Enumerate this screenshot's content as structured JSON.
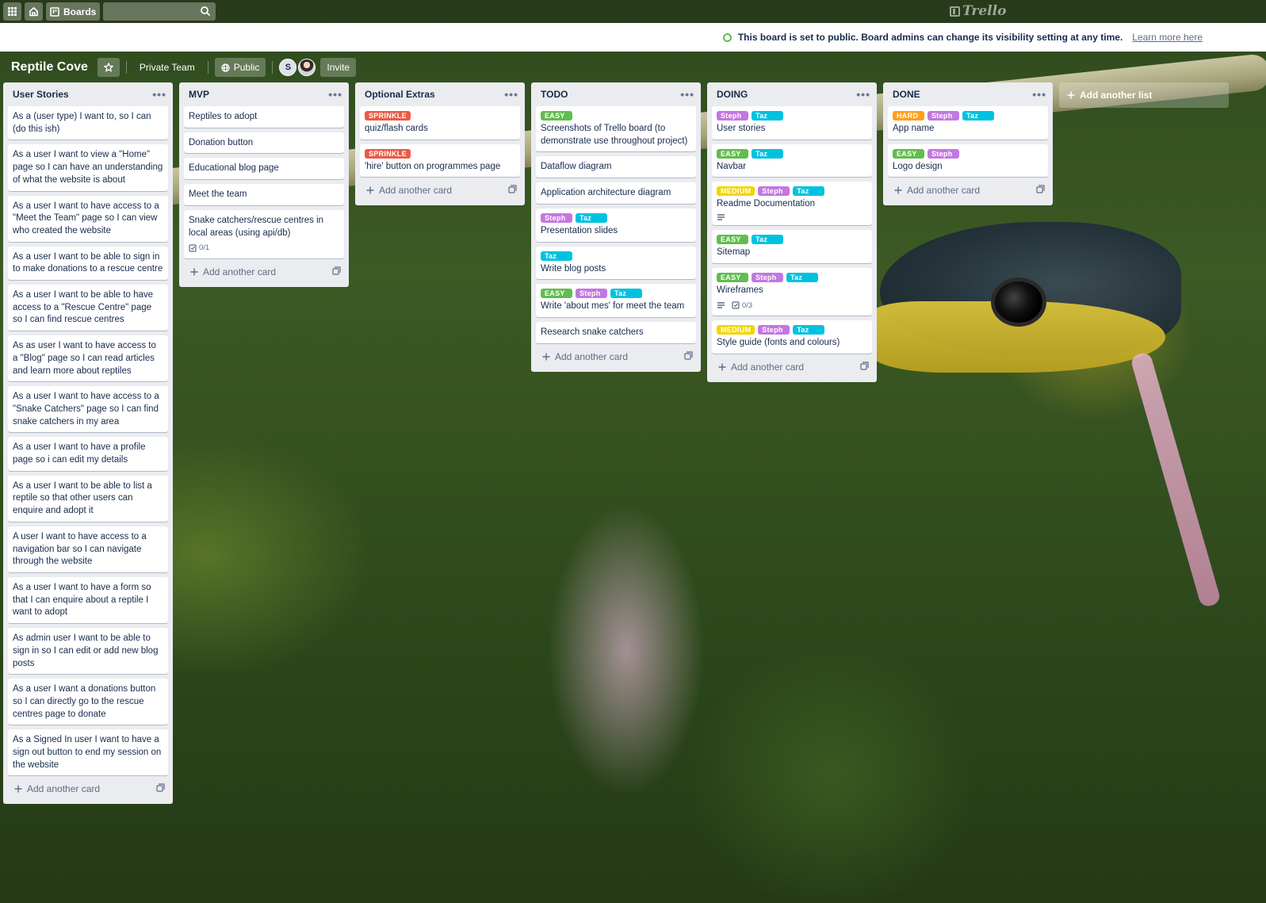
{
  "topbar": {
    "boards_label": "Boards",
    "logo_text": "Trello"
  },
  "banner": {
    "message": "This board is set to public. Board admins can change its visibility setting at any time.",
    "link": "Learn more here"
  },
  "board": {
    "title": "Reptile Cove",
    "team": "Private Team",
    "visibility": "Public",
    "member_initial": "S",
    "invite_label": "Invite",
    "add_list_label": "Add another list"
  },
  "label_colors": {
    "green": "#61bd4f",
    "red": "#eb5a46",
    "orange": "#ff9f1a",
    "yellow": "#f2d600",
    "purple": "#c377e0",
    "sky": "#00c2e0"
  },
  "add_card_label": "Add another card",
  "lists": [
    {
      "title": "User Stories",
      "cards": [
        {
          "title": "As a (user type) I want to, so I can (do this ish)",
          "labels": []
        },
        {
          "title": "As a user I want to view a \"Home\" page so I can have an understanding of what the website is about",
          "labels": []
        },
        {
          "title": "As a user I want to have access to a \"Meet the Team\" page so I can view who created the website",
          "labels": []
        },
        {
          "title": "As a user I want to be able to sign in to make donations to a rescue centre",
          "labels": []
        },
        {
          "title": "As a user I want to be able to have access to a \"Rescue Centre\" page so I can find rescue centres",
          "labels": []
        },
        {
          "title": "As as user I want to have access to a \"Blog\" page so I can read articles and learn more about reptiles",
          "labels": []
        },
        {
          "title": "As a user I want to have access to a \"Snake Catchers\" page so I can find snake catchers in my area",
          "labels": []
        },
        {
          "title": "As a user I want to have a profile page so i can edit my details",
          "labels": []
        },
        {
          "title": "As a user I want to be able to list a reptile so that other users can enquire and adopt it",
          "labels": []
        },
        {
          "title": "A user I want to have access to a navigation bar so I can navigate through the website",
          "labels": []
        },
        {
          "title": "As a user I want to have a form so that I can enquire about a reptile I want to adopt",
          "labels": []
        },
        {
          "title": "As admin user I want to be able to sign in so I can edit or add new blog posts",
          "labels": []
        },
        {
          "title": "As a user I want a donations button so I can directly go to the rescue centres page to donate",
          "labels": []
        },
        {
          "title": "As a Signed In user I want to have a sign out button to end my session on the website",
          "labels": []
        }
      ]
    },
    {
      "title": "MVP",
      "cards": [
        {
          "title": "Reptiles to adopt",
          "labels": []
        },
        {
          "title": "Donation button",
          "labels": []
        },
        {
          "title": "Educational blog page",
          "labels": []
        },
        {
          "title": "Meet the team",
          "labels": []
        },
        {
          "title": "Snake catchers/rescue centres in local areas (using api/db)",
          "labels": [],
          "checklist": "0/1"
        }
      ]
    },
    {
      "title": "Optional Extras",
      "cards": [
        {
          "title": "quiz/flash cards",
          "labels": [
            {
              "text": "SPRINKLE",
              "color": "#eb5a46"
            }
          ]
        },
        {
          "title": "'hire' button on programmes page",
          "labels": [
            {
              "text": "SPRINKLE",
              "color": "#eb5a46"
            }
          ]
        }
      ]
    },
    {
      "title": "TODO",
      "cards": [
        {
          "title": "Screenshots of Trello board (to demonstrate use throughout project)",
          "labels": [
            {
              "text": "EASY",
              "color": "#61bd4f"
            }
          ]
        },
        {
          "title": "Dataflow diagram",
          "labels": []
        },
        {
          "title": "Application architecture diagram",
          "labels": []
        },
        {
          "title": "Presentation slides",
          "labels": [
            {
              "text": "Steph",
              "color": "#c377e0"
            },
            {
              "text": "Taz",
              "color": "#00c2e0"
            }
          ]
        },
        {
          "title": "Write blog posts",
          "labels": [
            {
              "text": "Taz",
              "color": "#00c2e0"
            }
          ]
        },
        {
          "title": "Write 'about mes' for meet the team",
          "labels": [
            {
              "text": "EASY",
              "color": "#61bd4f"
            },
            {
              "text": "Steph",
              "color": "#c377e0"
            },
            {
              "text": "Taz",
              "color": "#00c2e0"
            }
          ]
        },
        {
          "title": "Research snake catchers",
          "labels": []
        }
      ]
    },
    {
      "title": "DOING",
      "cards": [
        {
          "title": "User stories",
          "labels": [
            {
              "text": "Steph",
              "color": "#c377e0"
            },
            {
              "text": "Taz",
              "color": "#00c2e0"
            }
          ]
        },
        {
          "title": "Navbar",
          "labels": [
            {
              "text": "EASY",
              "color": "#61bd4f"
            },
            {
              "text": "Taz",
              "color": "#00c2e0"
            }
          ]
        },
        {
          "title": "Readme Documentation",
          "labels": [
            {
              "text": "MEDIUM",
              "color": "#f2d600"
            },
            {
              "text": "Steph",
              "color": "#c377e0"
            },
            {
              "text": "Taz",
              "color": "#00c2e0"
            }
          ],
          "description": true
        },
        {
          "title": "Sitemap",
          "labels": [
            {
              "text": "EASY",
              "color": "#61bd4f"
            },
            {
              "text": "Taz",
              "color": "#00c2e0"
            }
          ]
        },
        {
          "title": "Wireframes",
          "labels": [
            {
              "text": "EASY",
              "color": "#61bd4f"
            },
            {
              "text": "Steph",
              "color": "#c377e0"
            },
            {
              "text": "Taz",
              "color": "#00c2e0"
            }
          ],
          "description": true,
          "checklist": "0/3"
        },
        {
          "title": "Style guide (fonts and colours)",
          "labels": [
            {
              "text": "MEDIUM",
              "color": "#f2d600"
            },
            {
              "text": "Steph",
              "color": "#c377e0"
            },
            {
              "text": "Taz",
              "color": "#00c2e0"
            }
          ]
        }
      ]
    },
    {
      "title": "DONE",
      "cards": [
        {
          "title": "App name",
          "labels": [
            {
              "text": "HARD",
              "color": "#ff9f1a"
            },
            {
              "text": "Steph",
              "color": "#c377e0"
            },
            {
              "text": "Taz",
              "color": "#00c2e0"
            }
          ]
        },
        {
          "title": "Logo design",
          "labels": [
            {
              "text": "EASY",
              "color": "#61bd4f"
            },
            {
              "text": "Steph",
              "color": "#c377e0"
            }
          ]
        }
      ]
    }
  ]
}
